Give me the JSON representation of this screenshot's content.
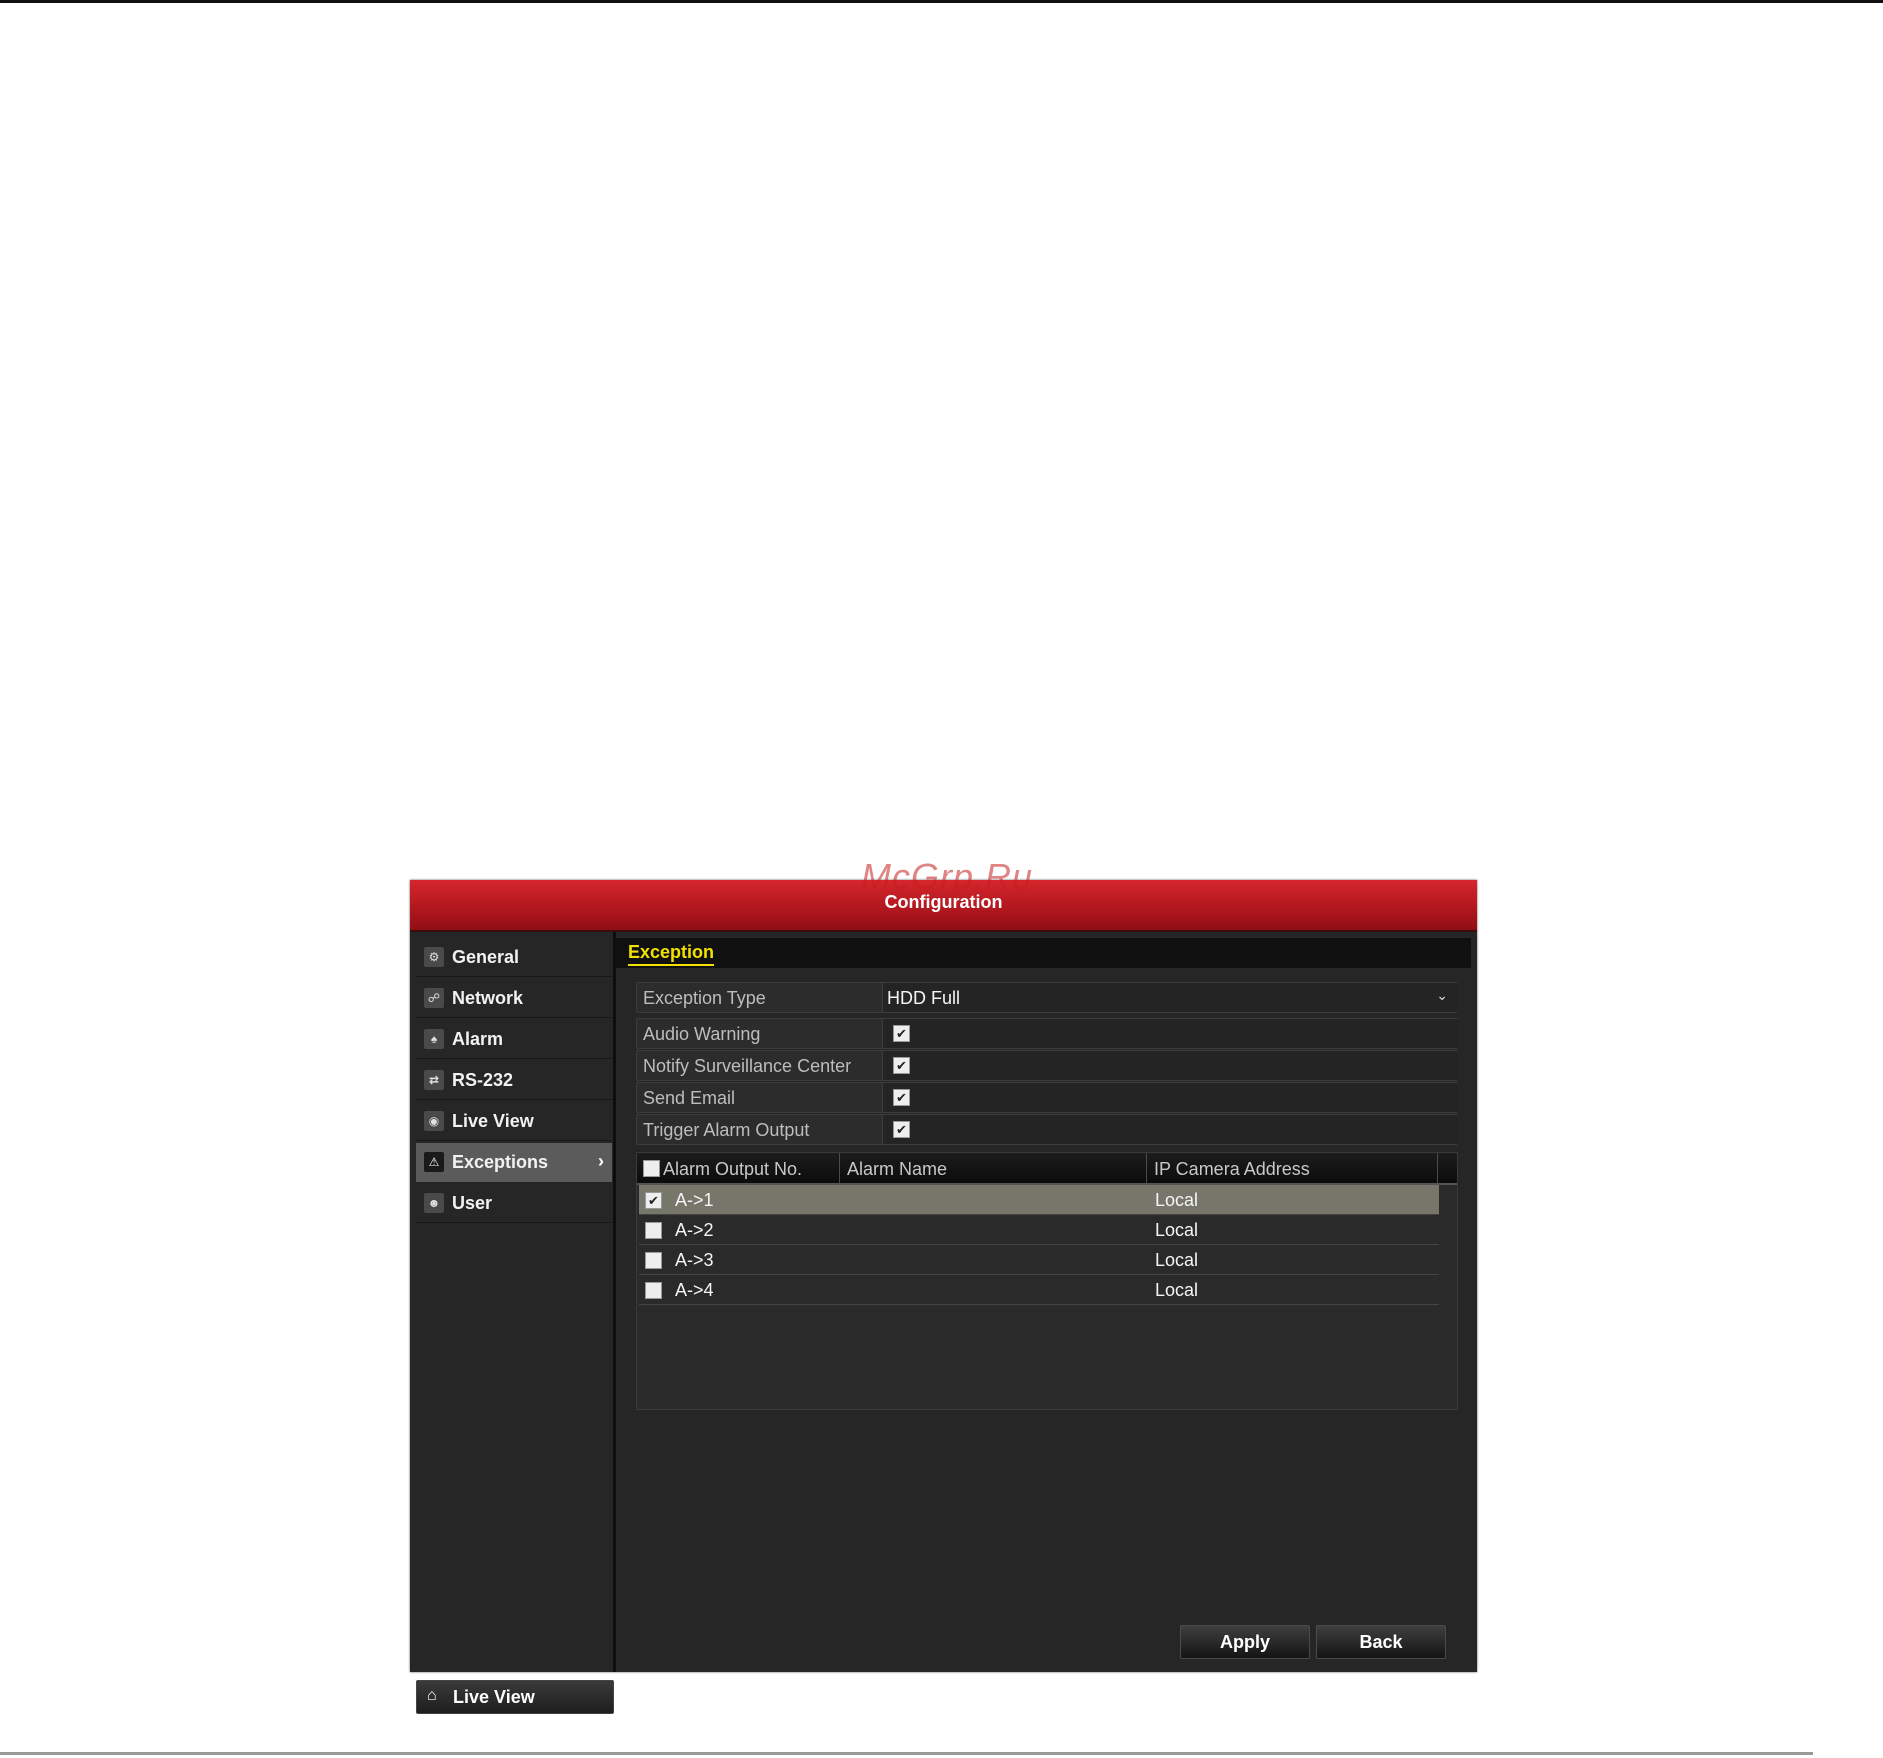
{
  "watermark": "McGrp.Ru",
  "window": {
    "title": "Configuration"
  },
  "sidebar": {
    "items": [
      {
        "label": "General",
        "icon": "gear-icon",
        "glyph": "⚙"
      },
      {
        "label": "Network",
        "icon": "network-icon",
        "glyph": "☍"
      },
      {
        "label": "Alarm",
        "icon": "alarm-icon",
        "glyph": "♠"
      },
      {
        "label": "RS-232",
        "icon": "serial-port-icon",
        "glyph": "⇄"
      },
      {
        "label": "Live View",
        "icon": "eye-icon",
        "glyph": "◉"
      },
      {
        "label": "Exceptions",
        "icon": "warning-icon",
        "glyph": "⚠",
        "active": true
      },
      {
        "label": "User",
        "icon": "users-icon",
        "glyph": "☻"
      }
    ],
    "active_chevron": "›",
    "bottom_button": {
      "label": "Live View",
      "icon": "home-icon",
      "glyph": "⌂"
    }
  },
  "tab": {
    "label": "Exception"
  },
  "form": {
    "exception_type": {
      "label": "Exception Type",
      "value": "HDD Full",
      "chevron": "⌄"
    },
    "checks": [
      {
        "label": "Audio Warning",
        "checked": true
      },
      {
        "label": "Notify Surveillance Center",
        "checked": true
      },
      {
        "label": "Send Email",
        "checked": true
      },
      {
        "label": "Trigger Alarm Output",
        "checked": true
      }
    ],
    "check_glyph": "✔"
  },
  "table": {
    "columns": [
      "Alarm Output No.",
      "Alarm Name",
      "IP Camera Address"
    ],
    "rows": [
      {
        "no": "A->1",
        "name": "",
        "address": "Local",
        "checked": true,
        "selected": true
      },
      {
        "no": "A->2",
        "name": "",
        "address": "Local",
        "checked": false
      },
      {
        "no": "A->3",
        "name": "",
        "address": "Local",
        "checked": false
      },
      {
        "no": "A->4",
        "name": "",
        "address": "Local",
        "checked": false
      }
    ]
  },
  "buttons": {
    "apply": "Apply",
    "back": "Back"
  },
  "colors": {
    "title_red": "#c41e25",
    "tab_yellow": "#f2e000",
    "selected_row": "#77766a"
  }
}
